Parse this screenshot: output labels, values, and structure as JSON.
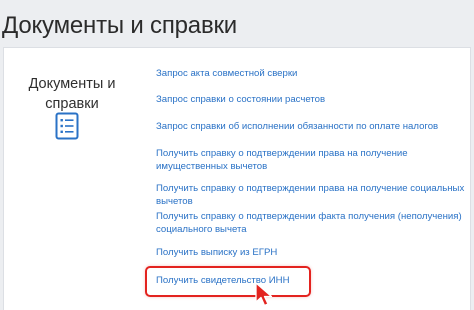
{
  "header": {
    "title": "Документы и справки"
  },
  "section": {
    "label": "Документы и\nсправки",
    "icon": "document-list-icon"
  },
  "links": [
    {
      "label": "Запрос акта совместной сверки"
    },
    {
      "label": "Запрос справки о состоянии расчетов"
    },
    {
      "label": "Запрос справки об исполнении обязанности по оплате налогов"
    },
    {
      "label": "Получить справку о подтверждении права на получение имущественных вычетов"
    },
    {
      "label": "Получить справку о подтверждении права на получение социальных вычетов"
    },
    {
      "label": "Получить справку о подтверждении факта получения (неполучения) социального вычета"
    },
    {
      "label": "Получить выписку из ЕГРН"
    },
    {
      "label": "Получить свидетельство ИНН"
    }
  ],
  "colors": {
    "link": "#2a72c6",
    "highlight": "#e3231f",
    "icon": "#2a72c6",
    "cursor": "#e3231f"
  },
  "highlighted_link_index": 7
}
